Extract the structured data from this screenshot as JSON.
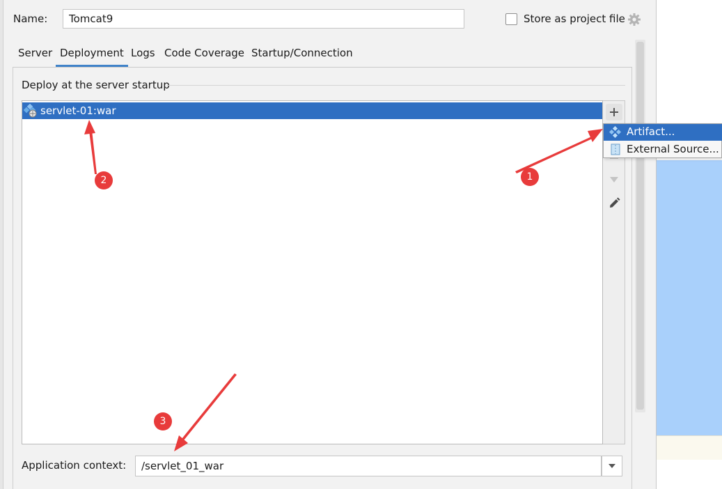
{
  "name_row": {
    "label": "Name:",
    "value": "Tomcat9",
    "store_checked": false,
    "store_label": "Store as project file"
  },
  "tabs": [
    {
      "label": "Server"
    },
    {
      "label": "Deployment",
      "active": true
    },
    {
      "label": "Logs"
    },
    {
      "label": "Code Coverage"
    },
    {
      "label": "Startup/Connection"
    }
  ],
  "deploy": {
    "title": "Deploy at the server startup",
    "items": [
      {
        "label": "servlet-01:war",
        "selected": true
      }
    ]
  },
  "popup_menu": {
    "items": [
      {
        "label": "Artifact...",
        "icon": "artifact-icon",
        "highlighted": true
      },
      {
        "label": "External Source...",
        "icon": "external-source-icon"
      }
    ]
  },
  "context": {
    "label": "Application context:",
    "value": "/servlet_01_war"
  },
  "annotations": {
    "badges": [
      "1",
      "2",
      "3"
    ],
    "color": "#e83b3b"
  },
  "colors": {
    "selection": "#2f6fc2",
    "active_tab_underline": "#4083c9"
  }
}
